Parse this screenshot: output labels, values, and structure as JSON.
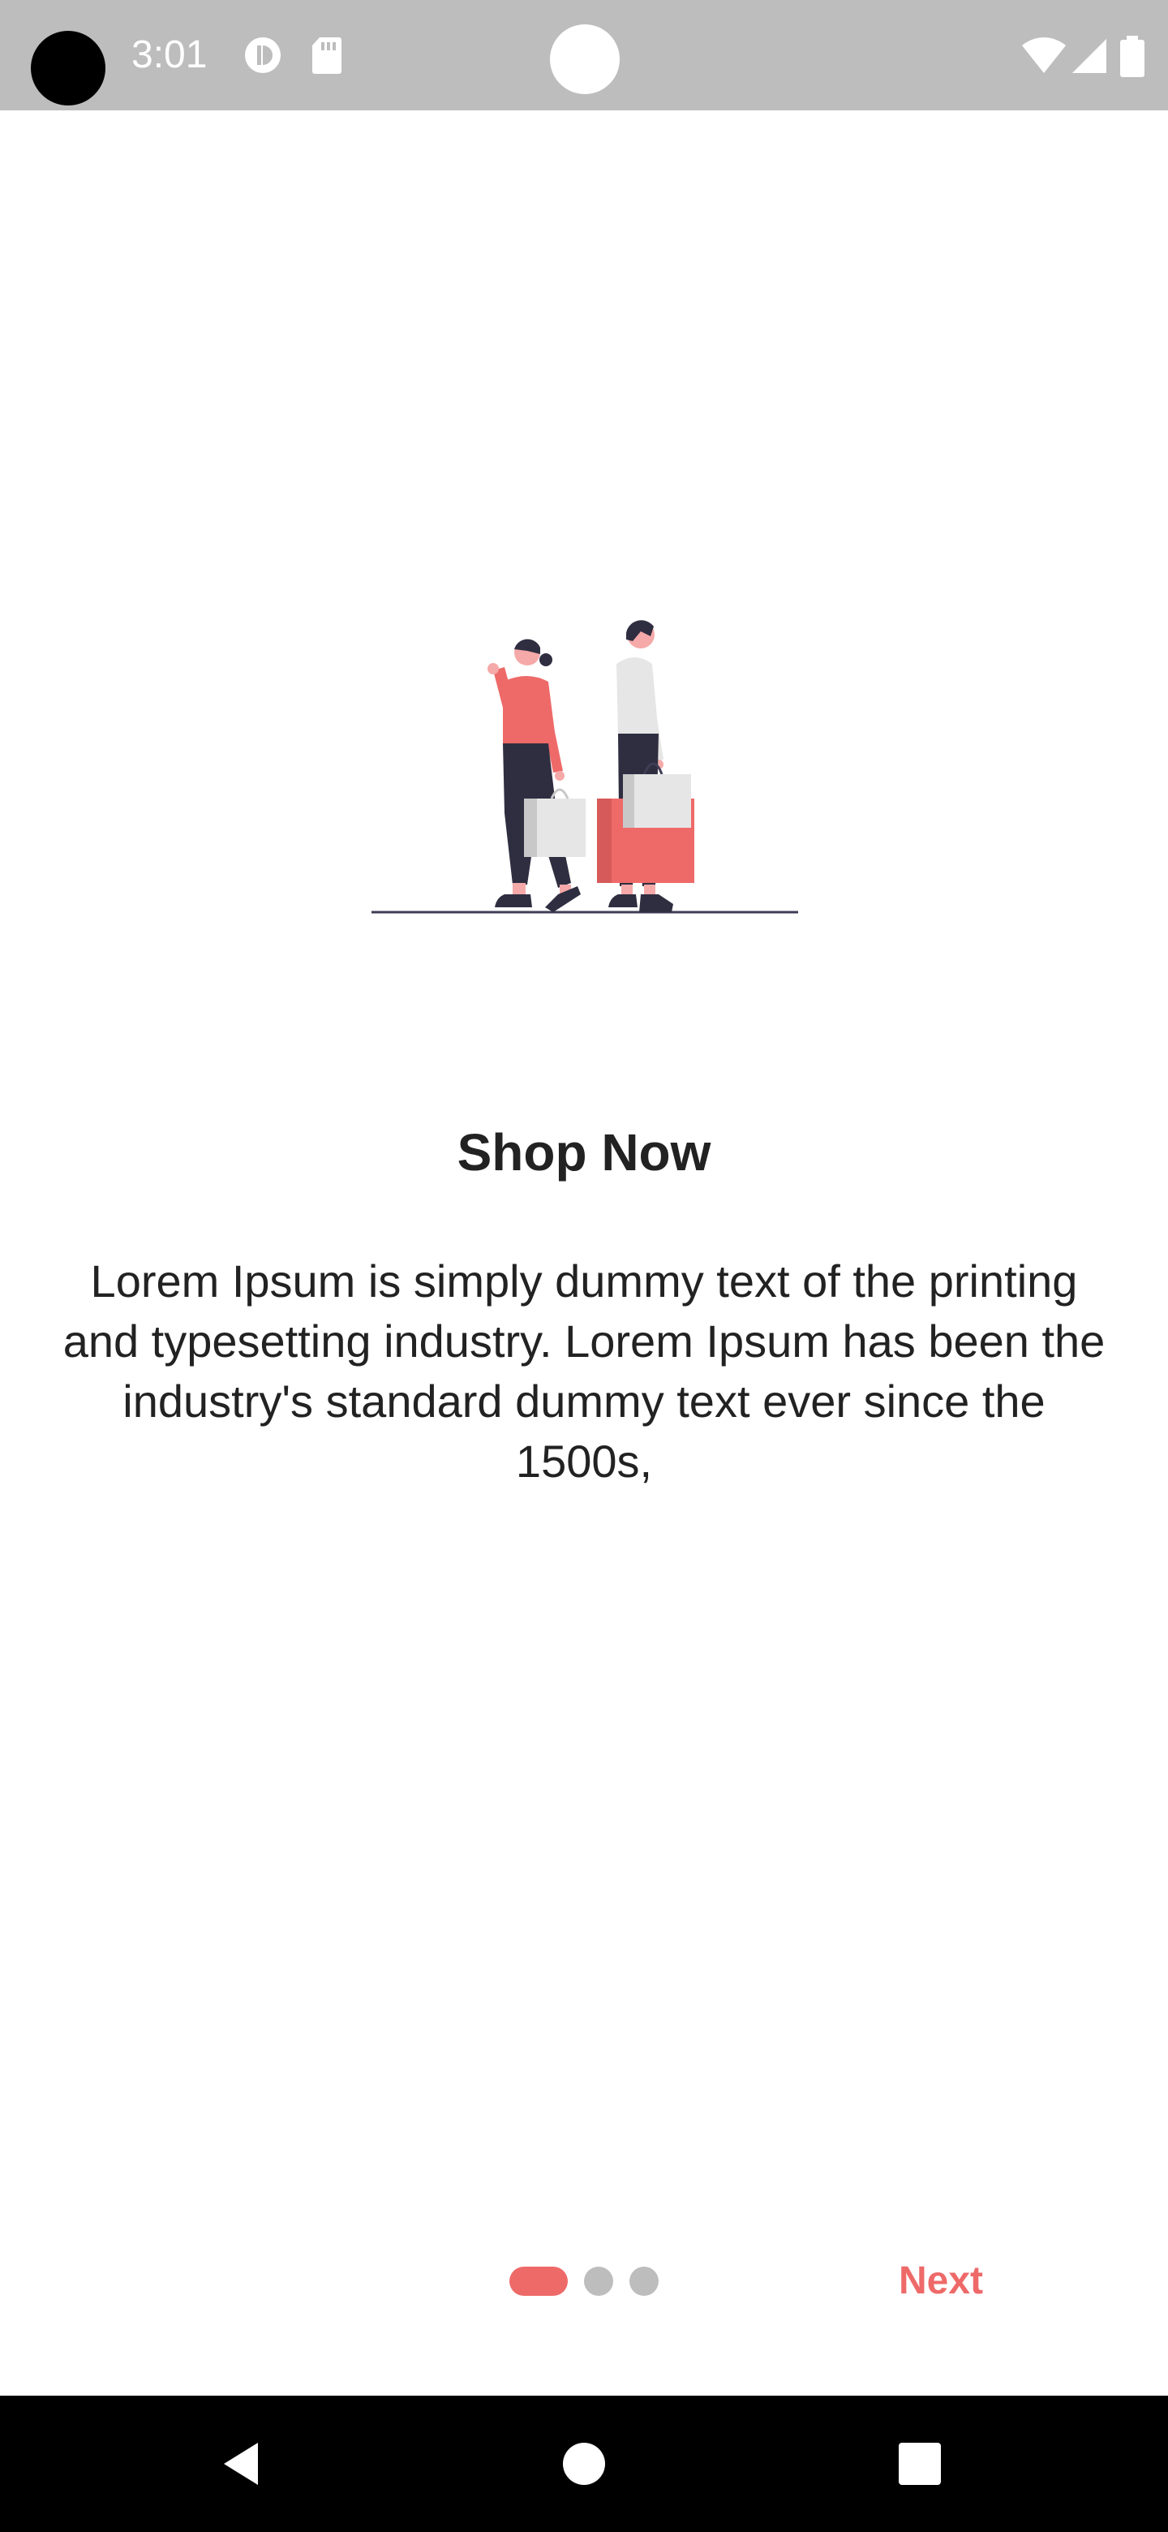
{
  "status_bar": {
    "time": "3:01",
    "icons": [
      "data-saver-icon",
      "sd-card-icon",
      "wifi-icon",
      "signal-icon",
      "battery-icon"
    ],
    "background": "#bdbdbd"
  },
  "onboarding": {
    "title": "Shop Now",
    "description": "Lorem Ipsum is simply dummy text of the printing and typesetting industry. Lorem Ipsum has been the industry's standard dummy text ever since the 1500s,",
    "illustration": "shopping-people-illustration",
    "page_indicator": {
      "total": 3,
      "current": 1
    },
    "next_label": "Next",
    "accent_color": "#ee6a69"
  },
  "nav_bar": {
    "buttons": [
      "back-icon",
      "home-icon",
      "recents-icon"
    ]
  }
}
